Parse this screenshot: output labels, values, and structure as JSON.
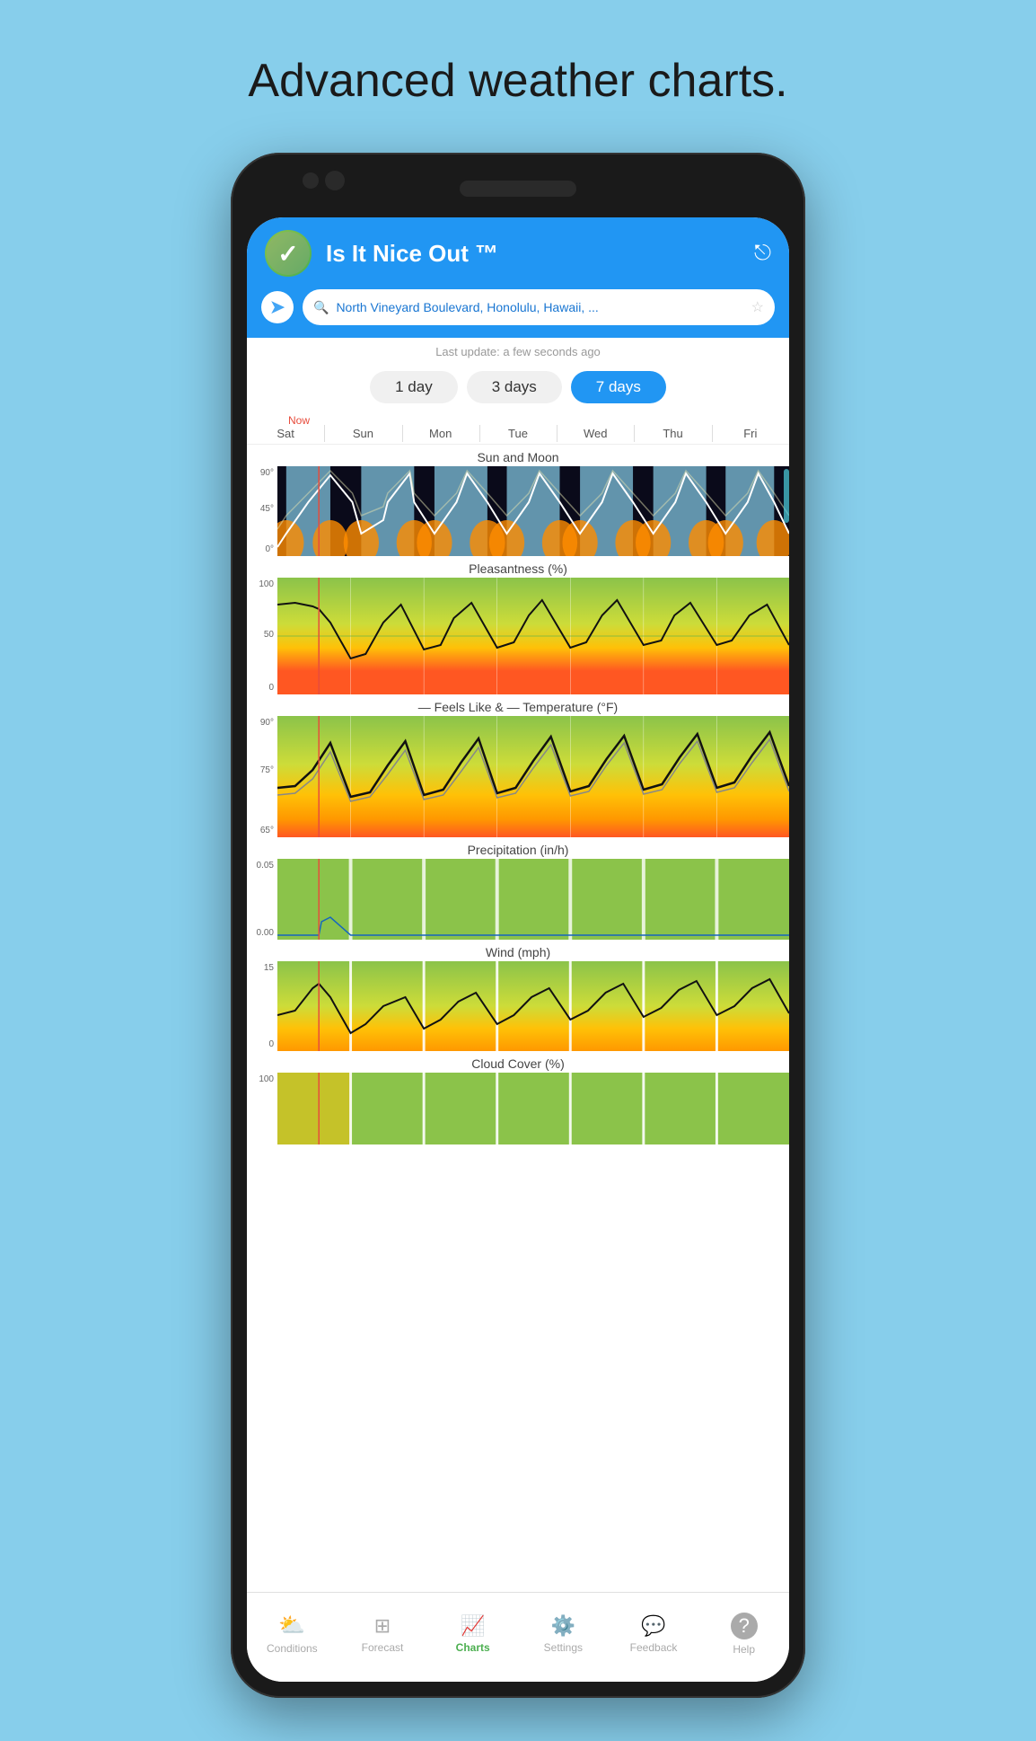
{
  "page": {
    "heading": "Advanced weather charts.",
    "background_color": "#87CEEB"
  },
  "app": {
    "title": "Is It Nice Out ™",
    "location": "North Vineyard Boulevard, Honolulu, Hawaii, ...",
    "last_update": "Last update: a few seconds ago"
  },
  "day_buttons": {
    "option1": "1 day",
    "option2": "3 days",
    "option3": "7 days",
    "active": "7 days"
  },
  "days": {
    "now_label": "Now",
    "labels": [
      "Sat",
      "Sun",
      "Mon",
      "Tue",
      "Wed",
      "Thu",
      "Fri"
    ]
  },
  "charts": [
    {
      "title": "Sun and Moon",
      "y_top": "90°",
      "y_mid": "45°",
      "y_bot": "0°"
    },
    {
      "title": "Pleasantness (%)",
      "y_top": "100",
      "y_mid": "50",
      "y_bot": "0"
    },
    {
      "title": "— Feels Like & — Temperature (°F)",
      "y_top": "90°",
      "y_mid": "75°",
      "y_bot": "65°"
    },
    {
      "title": "Precipitation (in/h)",
      "y_top": "0.05",
      "y_mid": "",
      "y_bot": "0.00"
    },
    {
      "title": "Wind (mph)",
      "y_top": "15",
      "y_mid": "",
      "y_bot": "0"
    },
    {
      "title": "Cloud Cover (%)",
      "y_top": "100",
      "y_mid": "",
      "y_bot": ""
    }
  ],
  "bottom_nav": {
    "items": [
      {
        "label": "Conditions",
        "icon": "☁",
        "active": false
      },
      {
        "label": "Forecast",
        "icon": "⊞",
        "active": false
      },
      {
        "label": "Charts",
        "icon": "📈",
        "active": true
      },
      {
        "label": "Settings",
        "icon": "⚙",
        "active": false
      },
      {
        "label": "Feedback",
        "icon": "💬",
        "active": false
      },
      {
        "label": "Help",
        "icon": "?",
        "active": false
      }
    ]
  }
}
